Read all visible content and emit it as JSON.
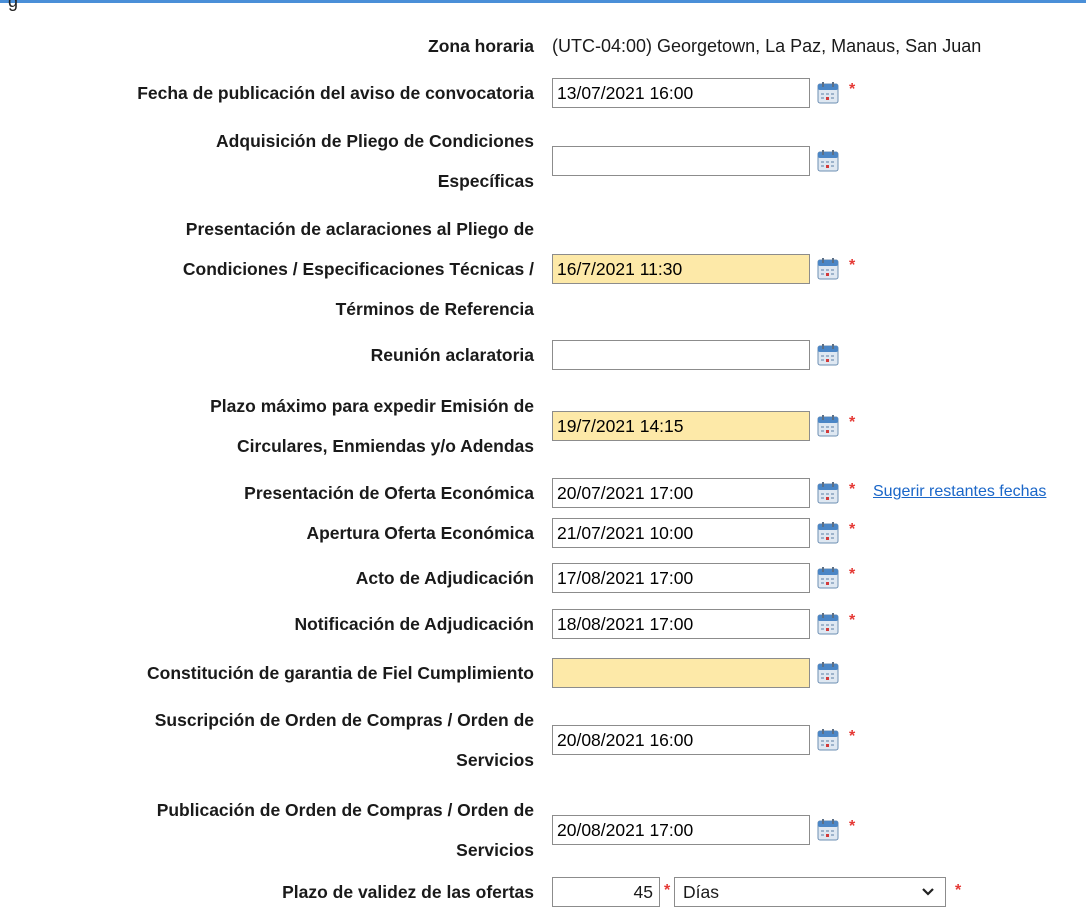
{
  "header": {
    "fragment": "g"
  },
  "colors": {
    "highlight": "#fde9a8",
    "required": "#e53935",
    "link": "#1a66c8",
    "accent_line": "#4a8fd8"
  },
  "timezone": {
    "label": "Zona horaria",
    "value": "(UTC-04:00) Georgetown, La Paz, Manaus, San Juan"
  },
  "rows": [
    {
      "label_lines": [
        "Fecha de publicación del aviso de convocatoria"
      ],
      "value": "13/07/2021 16:00",
      "required": true,
      "highlighted": false
    },
    {
      "label_lines": [
        "Adquisición de Pliego de Condiciones",
        "Específicas"
      ],
      "value": "",
      "required": false,
      "highlighted": false
    },
    {
      "label_lines": [
        "Presentación de aclaraciones al Pliego de",
        "Condiciones / Especificaciones Técnicas /",
        "Términos de Referencia"
      ],
      "value": "16/7/2021 11:30",
      "required": true,
      "highlighted": true
    },
    {
      "label_lines": [
        "Reunión aclaratoria"
      ],
      "value": "",
      "required": false,
      "highlighted": false
    },
    {
      "label_lines": [
        "Plazo máximo para expedir Emisión de",
        "Circulares, Enmiendas y/o Adendas"
      ],
      "value": "19/7/2021 14:15",
      "required": true,
      "highlighted": true
    },
    {
      "label_lines": [
        "Presentación de Oferta Económica"
      ],
      "value": "20/07/2021 17:00",
      "required": true,
      "highlighted": false,
      "link": "Sugerir restantes fechas"
    },
    {
      "label_lines": [
        "Apertura Oferta Económica"
      ],
      "value": "21/07/2021 10:00",
      "required": true,
      "highlighted": false
    },
    {
      "label_lines": [
        "Acto de Adjudicación"
      ],
      "value": "17/08/2021 17:00",
      "required": true,
      "highlighted": false
    },
    {
      "label_lines": [
        "Notificación de Adjudicación"
      ],
      "value": "18/08/2021 17:00",
      "required": true,
      "highlighted": false
    },
    {
      "label_lines": [
        "Constitución de garantia de Fiel Cumplimiento"
      ],
      "value": "",
      "required": false,
      "highlighted": true
    },
    {
      "label_lines": [
        "Suscripción de Orden de Compras / Orden de",
        "Servicios"
      ],
      "value": "20/08/2021 16:00",
      "required": true,
      "highlighted": false
    },
    {
      "label_lines": [
        "Publicación de Orden de Compras / Orden de",
        "Servicios"
      ],
      "value": "20/08/2021 17:00",
      "required": true,
      "highlighted": false
    }
  ],
  "validity": {
    "label": "Plazo de validez de las ofertas",
    "number": "45",
    "unit": "Días"
  },
  "required_mark": "*"
}
